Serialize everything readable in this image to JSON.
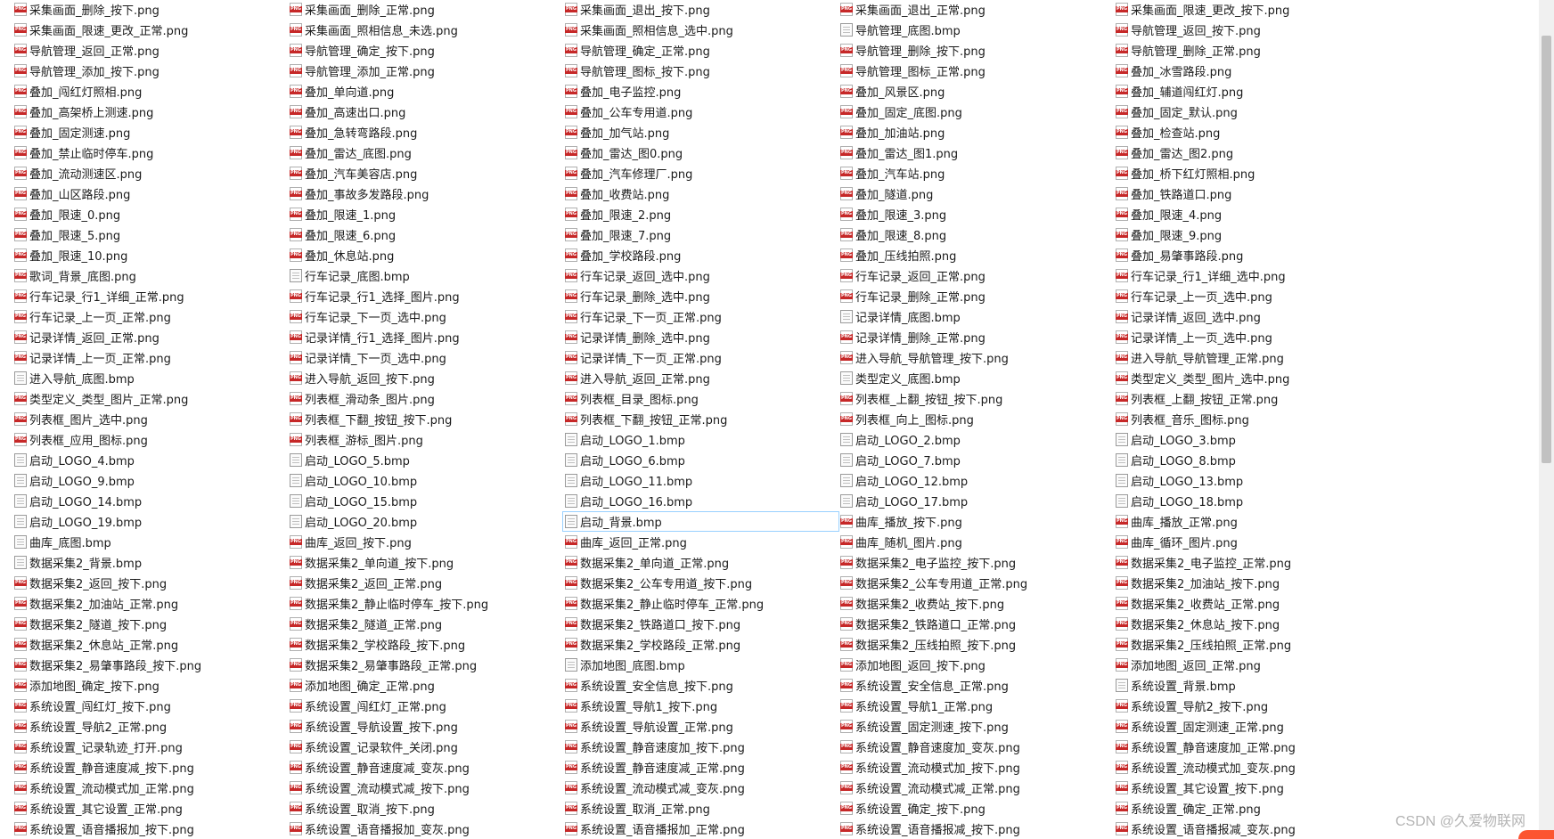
{
  "files": [
    {
      "name": "采集画面_删除_按下.png",
      "type": "png"
    },
    {
      "name": "采集画面_限速_更改_正常.png",
      "type": "png"
    },
    {
      "name": "导航管理_返回_正常.png",
      "type": "png"
    },
    {
      "name": "导航管理_添加_按下.png",
      "type": "png"
    },
    {
      "name": "叠加_闯红灯照相.png",
      "type": "png"
    },
    {
      "name": "叠加_高架桥上测速.png",
      "type": "png"
    },
    {
      "name": "叠加_固定测速.png",
      "type": "png"
    },
    {
      "name": "叠加_禁止临时停车.png",
      "type": "png"
    },
    {
      "name": "叠加_流动测速区.png",
      "type": "png"
    },
    {
      "name": "叠加_山区路段.png",
      "type": "png"
    },
    {
      "name": "叠加_限速_0.png",
      "type": "png"
    },
    {
      "name": "叠加_限速_5.png",
      "type": "png"
    },
    {
      "name": "叠加_限速_10.png",
      "type": "png"
    },
    {
      "name": "歌词_背景_底图.png",
      "type": "png"
    },
    {
      "name": "行车记录_行1_详细_正常.png",
      "type": "png"
    },
    {
      "name": "行车记录_上一页_正常.png",
      "type": "png"
    },
    {
      "name": "记录详情_返回_正常.png",
      "type": "png"
    },
    {
      "name": "记录详情_上一页_正常.png",
      "type": "png"
    },
    {
      "name": "进入导航_底图.bmp",
      "type": "bmp"
    },
    {
      "name": "类型定义_类型_图片_正常.png",
      "type": "png"
    },
    {
      "name": "列表框_图片_选中.png",
      "type": "png"
    },
    {
      "name": "列表框_应用_图标.png",
      "type": "png"
    },
    {
      "name": "启动_LOGO_4.bmp",
      "type": "bmp"
    },
    {
      "name": "启动_LOGO_9.bmp",
      "type": "bmp"
    },
    {
      "name": "启动_LOGO_14.bmp",
      "type": "bmp"
    },
    {
      "name": "启动_LOGO_19.bmp",
      "type": "bmp"
    },
    {
      "name": "曲库_底图.bmp",
      "type": "bmp"
    },
    {
      "name": "数据采集2_背景.bmp",
      "type": "bmp"
    },
    {
      "name": "数据采集2_返回_按下.png",
      "type": "png"
    },
    {
      "name": "数据采集2_加油站_正常.png",
      "type": "png"
    },
    {
      "name": "数据采集2_隧道_按下.png",
      "type": "png"
    },
    {
      "name": "数据采集2_休息站_正常.png",
      "type": "png"
    },
    {
      "name": "数据采集2_易肇事路段_按下.png",
      "type": "png"
    },
    {
      "name": "添加地图_确定_按下.png",
      "type": "png"
    },
    {
      "name": "系统设置_闯红灯_按下.png",
      "type": "png"
    },
    {
      "name": "系统设置_导航2_正常.png",
      "type": "png"
    },
    {
      "name": "系统设置_记录轨迹_打开.png",
      "type": "png"
    },
    {
      "name": "系统设置_静音速度减_按下.png",
      "type": "png"
    },
    {
      "name": "系统设置_流动模式加_正常.png",
      "type": "png"
    },
    {
      "name": "系统设置_其它设置_正常.png",
      "type": "png"
    },
    {
      "name": "系统设置_语音播报加_按下.png",
      "type": "png"
    },
    {
      "name": "采集画面_删除_正常.png",
      "type": "png"
    },
    {
      "name": "采集画面_照相信息_未选.png",
      "type": "png"
    },
    {
      "name": "导航管理_确定_按下.png",
      "type": "png"
    },
    {
      "name": "导航管理_添加_正常.png",
      "type": "png"
    },
    {
      "name": "叠加_单向道.png",
      "type": "png"
    },
    {
      "name": "叠加_高速出口.png",
      "type": "png"
    },
    {
      "name": "叠加_急转弯路段.png",
      "type": "png"
    },
    {
      "name": "叠加_雷达_底图.png",
      "type": "png"
    },
    {
      "name": "叠加_汽车美容店.png",
      "type": "png"
    },
    {
      "name": "叠加_事故多发路段.png",
      "type": "png"
    },
    {
      "name": "叠加_限速_1.png",
      "type": "png"
    },
    {
      "name": "叠加_限速_6.png",
      "type": "png"
    },
    {
      "name": "叠加_休息站.png",
      "type": "png"
    },
    {
      "name": "行车记录_底图.bmp",
      "type": "bmp"
    },
    {
      "name": "行车记录_行1_选择_图片.png",
      "type": "png"
    },
    {
      "name": "行车记录_下一页_选中.png",
      "type": "png"
    },
    {
      "name": "记录详情_行1_选择_图片.png",
      "type": "png"
    },
    {
      "name": "记录详情_下一页_选中.png",
      "type": "png"
    },
    {
      "name": "进入导航_返回_按下.png",
      "type": "png"
    },
    {
      "name": "列表框_滑动条_图片.png",
      "type": "png"
    },
    {
      "name": "列表框_下翻_按钮_按下.png",
      "type": "png"
    },
    {
      "name": "列表框_游标_图片.png",
      "type": "png"
    },
    {
      "name": "启动_LOGO_5.bmp",
      "type": "bmp"
    },
    {
      "name": "启动_LOGO_10.bmp",
      "type": "bmp"
    },
    {
      "name": "启动_LOGO_15.bmp",
      "type": "bmp"
    },
    {
      "name": "启动_LOGO_20.bmp",
      "type": "bmp"
    },
    {
      "name": "曲库_返回_按下.png",
      "type": "png"
    },
    {
      "name": "数据采集2_单向道_按下.png",
      "type": "png"
    },
    {
      "name": "数据采集2_返回_正常.png",
      "type": "png"
    },
    {
      "name": "数据采集2_静止临时停车_按下.png",
      "type": "png"
    },
    {
      "name": "数据采集2_隧道_正常.png",
      "type": "png"
    },
    {
      "name": "数据采集2_学校路段_按下.png",
      "type": "png"
    },
    {
      "name": "数据采集2_易肇事路段_正常.png",
      "type": "png"
    },
    {
      "name": "添加地图_确定_正常.png",
      "type": "png"
    },
    {
      "name": "系统设置_闯红灯_正常.png",
      "type": "png"
    },
    {
      "name": "系统设置_导航设置_按下.png",
      "type": "png"
    },
    {
      "name": "系统设置_记录软件_关闭.png",
      "type": "png"
    },
    {
      "name": "系统设置_静音速度减_变灰.png",
      "type": "png"
    },
    {
      "name": "系统设置_流动模式减_按下.png",
      "type": "png"
    },
    {
      "name": "系统设置_取消_按下.png",
      "type": "png"
    },
    {
      "name": "系统设置_语音播报加_变灰.png",
      "type": "png"
    },
    {
      "name": "采集画面_退出_按下.png",
      "type": "png"
    },
    {
      "name": "采集画面_照相信息_选中.png",
      "type": "png"
    },
    {
      "name": "导航管理_确定_正常.png",
      "type": "png"
    },
    {
      "name": "导航管理_图标_按下.png",
      "type": "png"
    },
    {
      "name": "叠加_电子监控.png",
      "type": "png"
    },
    {
      "name": "叠加_公车专用道.png",
      "type": "png"
    },
    {
      "name": "叠加_加气站.png",
      "type": "png"
    },
    {
      "name": "叠加_雷达_图0.png",
      "type": "png"
    },
    {
      "name": "叠加_汽车修理厂.png",
      "type": "png"
    },
    {
      "name": "叠加_收费站.png",
      "type": "png"
    },
    {
      "name": "叠加_限速_2.png",
      "type": "png"
    },
    {
      "name": "叠加_限速_7.png",
      "type": "png"
    },
    {
      "name": "叠加_学校路段.png",
      "type": "png"
    },
    {
      "name": "行车记录_返回_选中.png",
      "type": "png"
    },
    {
      "name": "行车记录_删除_选中.png",
      "type": "png"
    },
    {
      "name": "行车记录_下一页_正常.png",
      "type": "png"
    },
    {
      "name": "记录详情_删除_选中.png",
      "type": "png"
    },
    {
      "name": "记录详情_下一页_正常.png",
      "type": "png"
    },
    {
      "name": "进入导航_返回_正常.png",
      "type": "png"
    },
    {
      "name": "列表框_目录_图标.png",
      "type": "png"
    },
    {
      "name": "列表框_下翻_按钮_正常.png",
      "type": "png"
    },
    {
      "name": "启动_LOGO_1.bmp",
      "type": "bmp"
    },
    {
      "name": "启动_LOGO_6.bmp",
      "type": "bmp"
    },
    {
      "name": "启动_LOGO_11.bmp",
      "type": "bmp"
    },
    {
      "name": "启动_LOGO_16.bmp",
      "type": "bmp"
    },
    {
      "name": "启动_背景.bmp",
      "type": "bmp",
      "focused": true
    },
    {
      "name": "曲库_返回_正常.png",
      "type": "png"
    },
    {
      "name": "数据采集2_单向道_正常.png",
      "type": "png"
    },
    {
      "name": "数据采集2_公车专用道_按下.png",
      "type": "png"
    },
    {
      "name": "数据采集2_静止临时停车_正常.png",
      "type": "png"
    },
    {
      "name": "数据采集2_铁路道口_按下.png",
      "type": "png"
    },
    {
      "name": "数据采集2_学校路段_正常.png",
      "type": "png"
    },
    {
      "name": "添加地图_底图.bmp",
      "type": "bmp"
    },
    {
      "name": "系统设置_安全信息_按下.png",
      "type": "png"
    },
    {
      "name": "系统设置_导航1_按下.png",
      "type": "png"
    },
    {
      "name": "系统设置_导航设置_正常.png",
      "type": "png"
    },
    {
      "name": "系统设置_静音速度加_按下.png",
      "type": "png"
    },
    {
      "name": "系统设置_静音速度减_正常.png",
      "type": "png"
    },
    {
      "name": "系统设置_流动模式减_变灰.png",
      "type": "png"
    },
    {
      "name": "系统设置_取消_正常.png",
      "type": "png"
    },
    {
      "name": "系统设置_语音播报加_正常.png",
      "type": "png"
    },
    {
      "name": "采集画面_退出_正常.png",
      "type": "png"
    },
    {
      "name": "导航管理_底图.bmp",
      "type": "bmp"
    },
    {
      "name": "导航管理_删除_按下.png",
      "type": "png"
    },
    {
      "name": "导航管理_图标_正常.png",
      "type": "png"
    },
    {
      "name": "叠加_风景区.png",
      "type": "png"
    },
    {
      "name": "叠加_固定_底图.png",
      "type": "png"
    },
    {
      "name": "叠加_加油站.png",
      "type": "png"
    },
    {
      "name": "叠加_雷达_图1.png",
      "type": "png"
    },
    {
      "name": "叠加_汽车站.png",
      "type": "png"
    },
    {
      "name": "叠加_隧道.png",
      "type": "png"
    },
    {
      "name": "叠加_限速_3.png",
      "type": "png"
    },
    {
      "name": "叠加_限速_8.png",
      "type": "png"
    },
    {
      "name": "叠加_压线拍照.png",
      "type": "png"
    },
    {
      "name": "行车记录_返回_正常.png",
      "type": "png"
    },
    {
      "name": "行车记录_删除_正常.png",
      "type": "png"
    },
    {
      "name": "记录详情_底图.bmp",
      "type": "bmp"
    },
    {
      "name": "记录详情_删除_正常.png",
      "type": "png"
    },
    {
      "name": "进入导航_导航管理_按下.png",
      "type": "png"
    },
    {
      "name": "类型定义_底图.bmp",
      "type": "bmp"
    },
    {
      "name": "列表框_上翻_按钮_按下.png",
      "type": "png"
    },
    {
      "name": "列表框_向上_图标.png",
      "type": "png"
    },
    {
      "name": "启动_LOGO_2.bmp",
      "type": "bmp"
    },
    {
      "name": "启动_LOGO_7.bmp",
      "type": "bmp"
    },
    {
      "name": "启动_LOGO_12.bmp",
      "type": "bmp"
    },
    {
      "name": "启动_LOGO_17.bmp",
      "type": "bmp"
    },
    {
      "name": "曲库_播放_按下.png",
      "type": "png"
    },
    {
      "name": "曲库_随机_图片.png",
      "type": "png"
    },
    {
      "name": "数据采集2_电子监控_按下.png",
      "type": "png"
    },
    {
      "name": "数据采集2_公车专用道_正常.png",
      "type": "png"
    },
    {
      "name": "数据采集2_收费站_按下.png",
      "type": "png"
    },
    {
      "name": "数据采集2_铁路道口_正常.png",
      "type": "png"
    },
    {
      "name": "数据采集2_压线拍照_按下.png",
      "type": "png"
    },
    {
      "name": "添加地图_返回_按下.png",
      "type": "png"
    },
    {
      "name": "系统设置_安全信息_正常.png",
      "type": "png"
    },
    {
      "name": "系统设置_导航1_正常.png",
      "type": "png"
    },
    {
      "name": "系统设置_固定测速_按下.png",
      "type": "png"
    },
    {
      "name": "系统设置_静音速度加_变灰.png",
      "type": "png"
    },
    {
      "name": "系统设置_流动模式加_按下.png",
      "type": "png"
    },
    {
      "name": "系统设置_流动模式减_正常.png",
      "type": "png"
    },
    {
      "name": "系统设置_确定_按下.png",
      "type": "png"
    },
    {
      "name": "系统设置_语音播报减_按下.png",
      "type": "png"
    },
    {
      "name": "采集画面_限速_更改_按下.png",
      "type": "png"
    },
    {
      "name": "导航管理_返回_按下.png",
      "type": "png"
    },
    {
      "name": "导航管理_删除_正常.png",
      "type": "png"
    },
    {
      "name": "叠加_冰雪路段.png",
      "type": "png"
    },
    {
      "name": "叠加_辅道闯红灯.png",
      "type": "png"
    },
    {
      "name": "叠加_固定_默认.png",
      "type": "png"
    },
    {
      "name": "叠加_检查站.png",
      "type": "png"
    },
    {
      "name": "叠加_雷达_图2.png",
      "type": "png"
    },
    {
      "name": "叠加_桥下红灯照相.png",
      "type": "png"
    },
    {
      "name": "叠加_铁路道口.png",
      "type": "png"
    },
    {
      "name": "叠加_限速_4.png",
      "type": "png"
    },
    {
      "name": "叠加_限速_9.png",
      "type": "png"
    },
    {
      "name": "叠加_易肇事路段.png",
      "type": "png"
    },
    {
      "name": "行车记录_行1_详细_选中.png",
      "type": "png"
    },
    {
      "name": "行车记录_上一页_选中.png",
      "type": "png"
    },
    {
      "name": "记录详情_返回_选中.png",
      "type": "png"
    },
    {
      "name": "记录详情_上一页_选中.png",
      "type": "png"
    },
    {
      "name": "进入导航_导航管理_正常.png",
      "type": "png"
    },
    {
      "name": "类型定义_类型_图片_选中.png",
      "type": "png"
    },
    {
      "name": "列表框_上翻_按钮_正常.png",
      "type": "png"
    },
    {
      "name": "列表框_音乐_图标.png",
      "type": "png"
    },
    {
      "name": "启动_LOGO_3.bmp",
      "type": "bmp"
    },
    {
      "name": "启动_LOGO_8.bmp",
      "type": "bmp"
    },
    {
      "name": "启动_LOGO_13.bmp",
      "type": "bmp"
    },
    {
      "name": "启动_LOGO_18.bmp",
      "type": "bmp"
    },
    {
      "name": "曲库_播放_正常.png",
      "type": "png"
    },
    {
      "name": "曲库_循环_图片.png",
      "type": "png"
    },
    {
      "name": "数据采集2_电子监控_正常.png",
      "type": "png"
    },
    {
      "name": "数据采集2_加油站_按下.png",
      "type": "png"
    },
    {
      "name": "数据采集2_收费站_正常.png",
      "type": "png"
    },
    {
      "name": "数据采集2_休息站_按下.png",
      "type": "png"
    },
    {
      "name": "数据采集2_压线拍照_正常.png",
      "type": "png"
    },
    {
      "name": "添加地图_返回_正常.png",
      "type": "png"
    },
    {
      "name": "系统设置_背景.bmp",
      "type": "bmp"
    },
    {
      "name": "系统设置_导航2_按下.png",
      "type": "png"
    },
    {
      "name": "系统设置_固定测速_正常.png",
      "type": "png"
    },
    {
      "name": "系统设置_静音速度加_正常.png",
      "type": "png"
    },
    {
      "name": "系统设置_流动模式加_变灰.png",
      "type": "png"
    },
    {
      "name": "系统设置_其它设置_按下.png",
      "type": "png"
    },
    {
      "name": "系统设置_确定_正常.png",
      "type": "png"
    },
    {
      "name": "系统设置_语音播报减_变灰.png",
      "type": "png"
    }
  ],
  "watermark": "CSDN @久爱物联网"
}
